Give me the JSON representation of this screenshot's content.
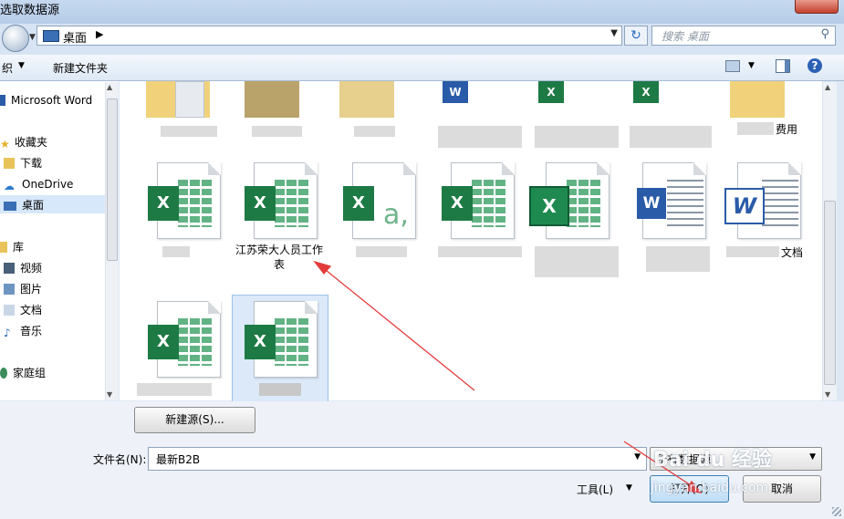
{
  "window": {
    "title": "选取数据源"
  },
  "address": {
    "location": "桌面",
    "search_placeholder": "搜索 桌面"
  },
  "toolbar": {
    "organize_label": "织",
    "new_folder_label": "新建文件夹"
  },
  "nav": {
    "items": [
      {
        "label": "Microsoft Word",
        "icon": "word-icon"
      },
      {
        "label": "收藏夹",
        "icon": "star-icon"
      },
      {
        "label": "下载",
        "icon": "download-folder-icon"
      },
      {
        "label": "OneDrive",
        "icon": "cloud-icon"
      },
      {
        "label": "桌面",
        "icon": "desktop-icon"
      },
      {
        "label": "库",
        "icon": "library-icon"
      },
      {
        "label": "视频",
        "icon": "video-icon"
      },
      {
        "label": "图片",
        "icon": "picture-icon"
      },
      {
        "label": "文档",
        "icon": "document-icon"
      },
      {
        "label": "音乐",
        "icon": "music-icon"
      },
      {
        "label": "家庭组",
        "icon": "homegroup-icon"
      }
    ]
  },
  "files": {
    "row1_partial_label": "费用",
    "row2": [
      {
        "label": "",
        "icon": "excel-icon"
      },
      {
        "label": "江苏荣大人员工作表",
        "icon": "excel-icon"
      },
      {
        "label": "",
        "icon": "excel-access-icon"
      },
      {
        "label": "",
        "icon": "excel-icon"
      },
      {
        "label": "",
        "icon": "excel-old-icon"
      },
      {
        "label": "",
        "icon": "word-icon"
      },
      {
        "label": "文档",
        "icon": "word-old-icon"
      }
    ],
    "row3": [
      {
        "label": "",
        "icon": "excel-icon"
      },
      {
        "label": "",
        "icon": "excel-icon"
      }
    ]
  },
  "bottom": {
    "new_source_label": "新建源(S)...",
    "filename_label": "文件名(N):",
    "filename_value": "最新B2B",
    "filetype_value": "所有数据源",
    "tools_label": "工具(L)",
    "open_label": "打开(O)",
    "cancel_label": "取消"
  },
  "watermark": {
    "brand": "Bai du 经验",
    "url": "jingyan.baidu.com"
  },
  "colors": {
    "accent": "#3c7fb1",
    "excel_green": "#1d7a44",
    "word_blue": "#2a5ba8",
    "arrow_red": "#e23b3b"
  }
}
